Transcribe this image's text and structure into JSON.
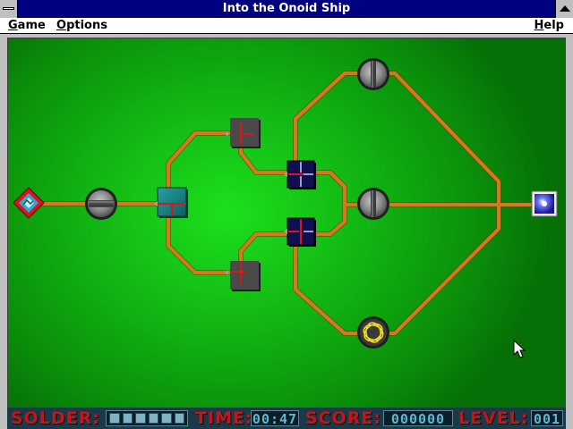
{
  "window": {
    "title": "Into the Onoid Ship"
  },
  "menu": {
    "game": "Game",
    "options": "Options",
    "help": "Help"
  },
  "status": {
    "solder_label": "SOLDER:",
    "solder_segments": 6,
    "time_label": "TIME:",
    "time_value": "00:47",
    "score_label": "SCORE:",
    "score_value": "000000",
    "level_label": "LEVEL:",
    "level_value": "001"
  },
  "colors": {
    "board_green": "#0fa80f",
    "wire": "#d8781c",
    "status_bg": "#1a3a4a",
    "status_label": "#c01818",
    "status_digits": "#5fb8cf",
    "titlebar": "#000080"
  },
  "icons": {
    "source": "red-diamond-source-icon",
    "end": "blue-square-target-icon",
    "resistor": "gray-disc-resistor-icon",
    "junction_teal": "teal-junction-icon",
    "junction_gray": "gray-junction-icon",
    "junction_navy": "navy-cross-junction-icon",
    "bulb": "yellow-bulb-icon",
    "pointer": "arrow-cursor-icon"
  }
}
